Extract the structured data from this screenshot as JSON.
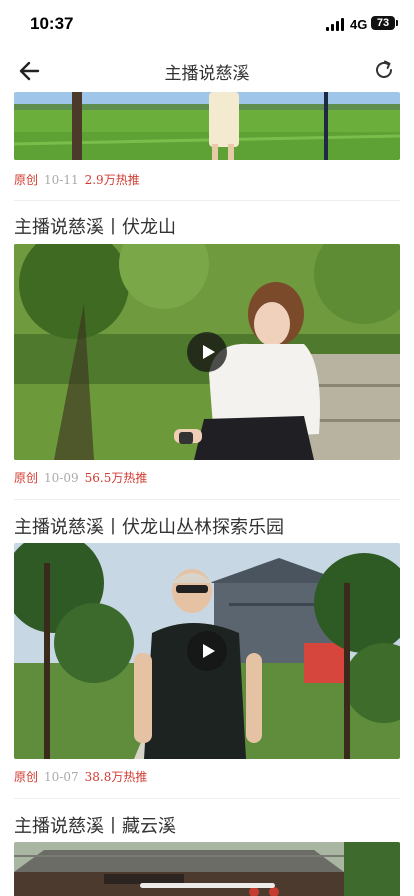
{
  "status_bar": {
    "time": "10:37",
    "network": "4G",
    "battery": "73"
  },
  "nav": {
    "title": "主播说慈溪",
    "back_icon": "arrow-left-icon",
    "refresh_icon": "refresh-icon"
  },
  "items": [
    {
      "title": "",
      "origin": "原创",
      "date": "10-11",
      "hot": "2.9万热推"
    },
    {
      "title": "主播说慈溪丨伏龙山",
      "origin": "原创",
      "date": "10-09",
      "hot": "56.5万热推"
    },
    {
      "title": "主播说慈溪丨伏龙山丛林探索乐园",
      "origin": "原创",
      "date": "10-07",
      "hot": "38.8万热推"
    },
    {
      "title": "主播说慈溪丨藏云溪",
      "origin": "",
      "date": "",
      "hot": ""
    }
  ],
  "colors": {
    "accent": "#d23b32",
    "meta_gray": "#aaaaaa",
    "divider": "#eeeeee"
  }
}
